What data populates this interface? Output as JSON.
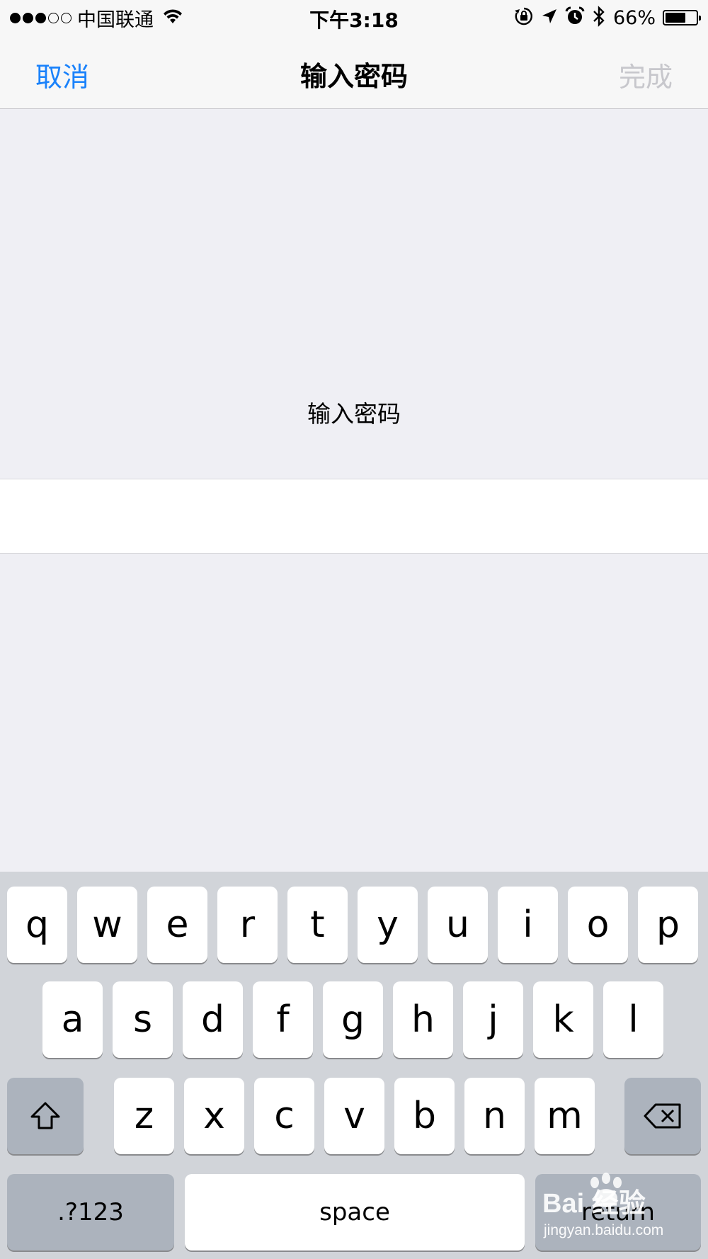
{
  "status_bar": {
    "signal_dots": "●●●○○",
    "carrier": "中国联通",
    "time": "下午3:18",
    "battery_percent": "66%",
    "battery_level": 0.66,
    "icons": [
      "wifi-icon",
      "orientation-lock-icon",
      "location-arrow-icon",
      "alarm-icon",
      "bluetooth-icon",
      "battery-icon"
    ]
  },
  "nav": {
    "cancel_label": "取消",
    "title": "输入密码",
    "done_label": "完成"
  },
  "content": {
    "prompt": "输入密码",
    "password_value": ""
  },
  "keyboard": {
    "row1": [
      "q",
      "w",
      "e",
      "r",
      "t",
      "y",
      "u",
      "i",
      "o",
      "p"
    ],
    "row2": [
      "a",
      "s",
      "d",
      "f",
      "g",
      "h",
      "j",
      "k",
      "l"
    ],
    "row3": [
      "z",
      "x",
      "c",
      "v",
      "b",
      "n",
      "m"
    ],
    "numbers_label": ".?123",
    "space_label": "space",
    "return_label": "return"
  },
  "watermark": {
    "brand": "Bai  经验",
    "url": "jingyan.baidu.com"
  },
  "colors": {
    "accent": "#1a82fb",
    "disabled": "#c7c7cc",
    "background": "#efeff4",
    "keyboard_bg": "#d1d4d9"
  }
}
